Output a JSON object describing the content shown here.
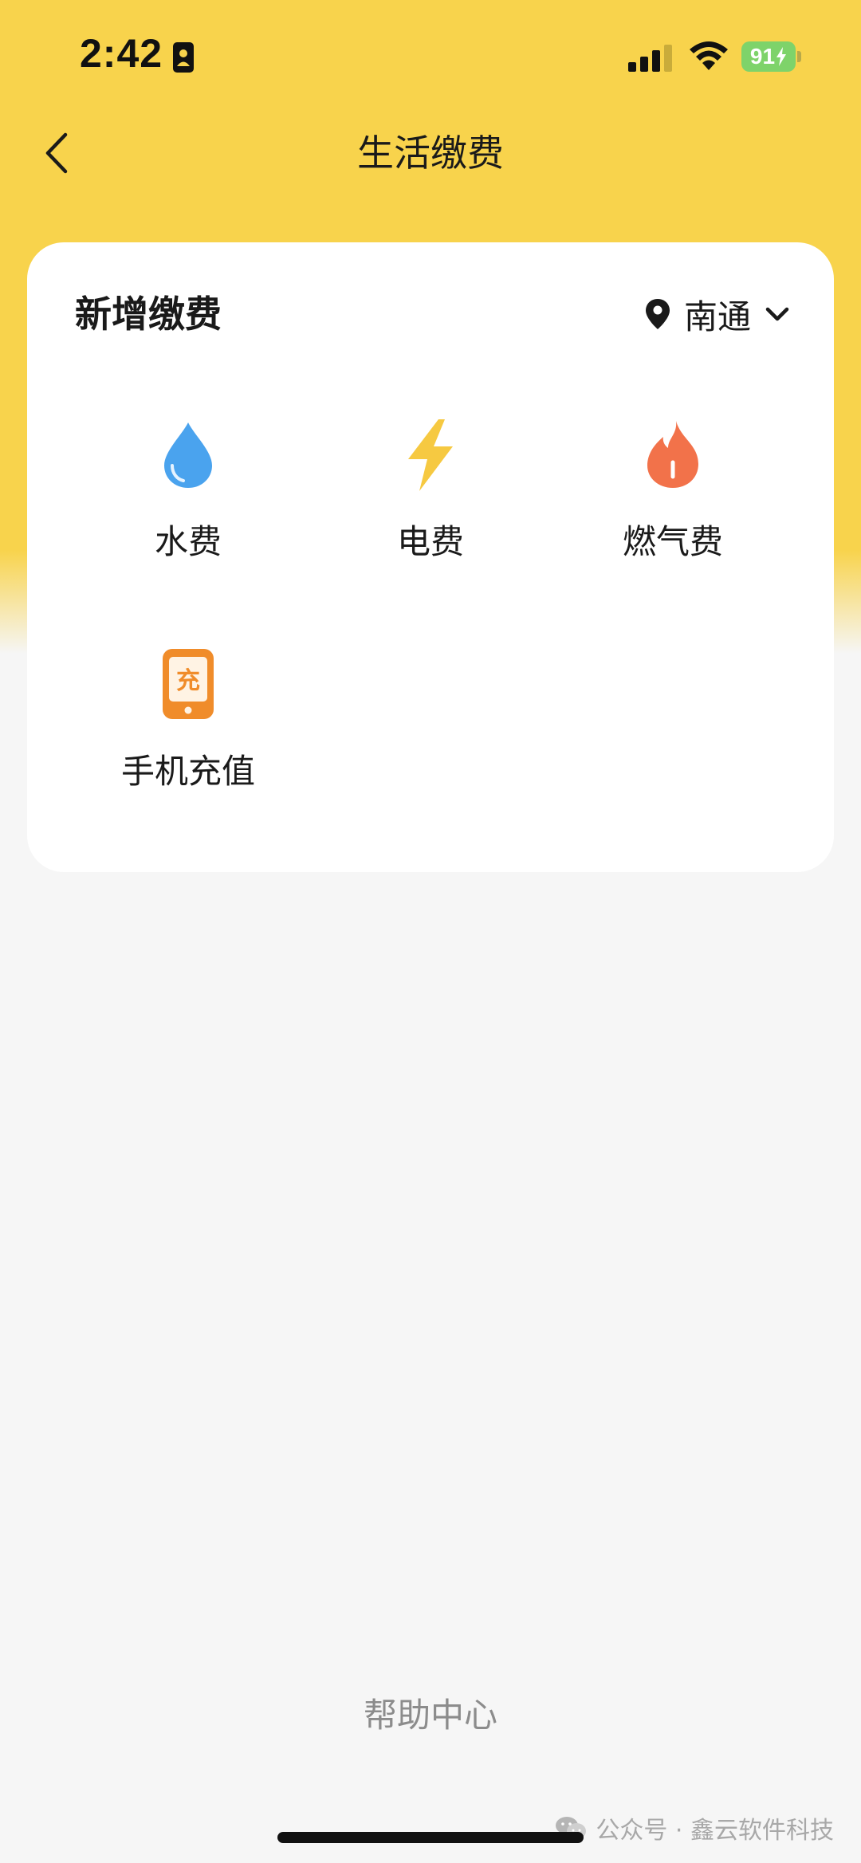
{
  "status_bar": {
    "time": "2:42",
    "battery": "91"
  },
  "nav": {
    "title": "生活缴费"
  },
  "card": {
    "title": "新增缴费",
    "location": "南通",
    "items": [
      {
        "label": "水费",
        "icon": "water-drop-icon"
      },
      {
        "label": "电费",
        "icon": "lightning-icon"
      },
      {
        "label": "燃气费",
        "icon": "flame-icon"
      },
      {
        "label": "手机充值",
        "icon": "phone-recharge-icon"
      }
    ]
  },
  "footer": {
    "help_center": "帮助中心",
    "watermark": "公众号 · 鑫云软件科技"
  },
  "colors": {
    "header_yellow": "#f8d34c",
    "page_background": "#f6f6f6",
    "water": "#4aa3ee",
    "electric": "#f6c941",
    "gas": "#f2724a",
    "phone": "#f08c2a"
  }
}
